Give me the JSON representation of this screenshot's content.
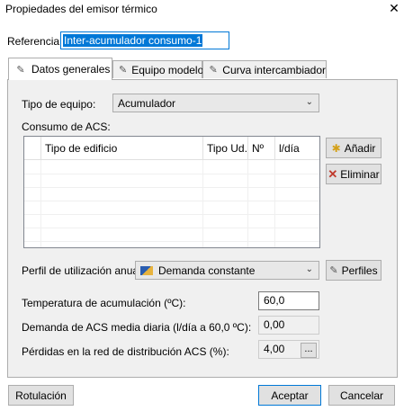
{
  "window": {
    "title": "Propiedades del emisor térmico",
    "close_icon": "close-icon"
  },
  "referencia": {
    "label": "Referencia:",
    "value": "Inter-acumulador consumo-1"
  },
  "tabs": [
    {
      "label": "Datos generales",
      "icon": "pencil-icon",
      "active": true
    },
    {
      "label": "Equipo modelo",
      "icon": "pencil-icon",
      "active": false
    },
    {
      "label": "Curva intercambiador",
      "icon": "pencil-icon",
      "active": false
    }
  ],
  "tipo_equipo": {
    "label": "Tipo de equipo:",
    "value": "Acumulador"
  },
  "consumo": {
    "label": "Consumo de ACS:",
    "columns": [
      "Tipo de edificio",
      "Tipo Ud.",
      "Nº",
      "l/día"
    ],
    "rows": [],
    "add_label": "Añadir",
    "delete_label": "Eliminar"
  },
  "perfil": {
    "label": "Perfil de utilización anual:",
    "value": "Demanda constante",
    "button_label": "Perfiles"
  },
  "temperatura": {
    "label": "Temperatura de acumulación (ºC):",
    "value": "60,0"
  },
  "demanda": {
    "label": "Demanda de ACS media diaria (l/día a 60,0 ºC):",
    "value": "0,00"
  },
  "perdidas": {
    "label": "Pérdidas en la red de distribución ACS (%):",
    "value": "4,00",
    "button_label": "..."
  },
  "footer": {
    "rotulacion": "Rotulación",
    "aceptar": "Aceptar",
    "cancelar": "Cancelar"
  },
  "colors": {
    "accent": "#0078d7",
    "panel": "#f0f0f0",
    "add_icon": "#d4a017",
    "delete_icon": "#c0392b"
  }
}
